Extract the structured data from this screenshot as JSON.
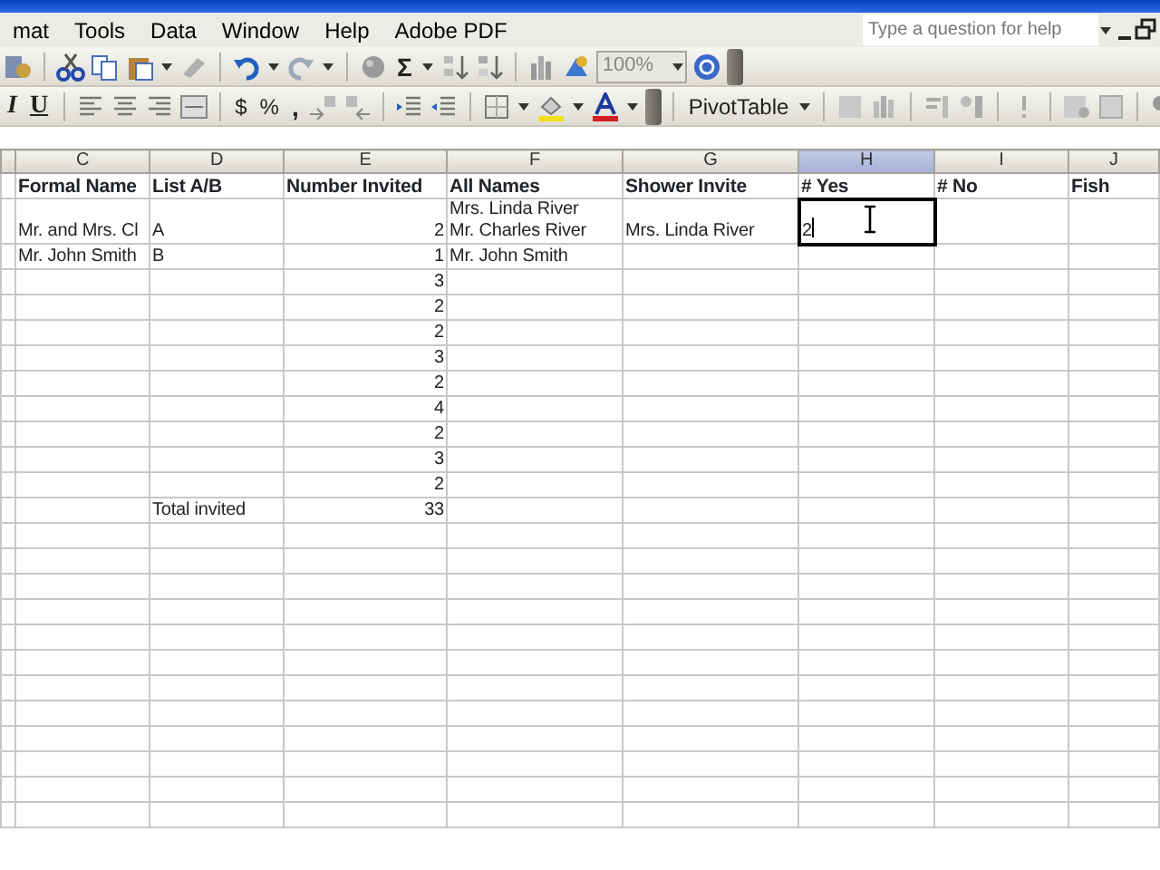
{
  "menu_bar": {
    "items": [
      "mat",
      "Tools",
      "Data",
      "Window",
      "Help",
      "Adobe PDF"
    ],
    "help_field": {
      "placeholder": "Type a question for help"
    }
  },
  "standard_toolbar": {
    "sum": "Σ",
    "zoom": "100%"
  },
  "formatting_toolbar": {
    "italic": "I",
    "underline": "U",
    "currency": "$",
    "percent": "%",
    "comma": ",",
    "pivot_table": "PivotTable"
  },
  "columns": [
    {
      "letter": "C",
      "kind": "text",
      "selected": false
    },
    {
      "letter": "D",
      "kind": "text",
      "selected": false
    },
    {
      "letter": "E",
      "kind": "number",
      "selected": false
    },
    {
      "letter": "F",
      "kind": "text",
      "selected": false
    },
    {
      "letter": "G",
      "kind": "text",
      "selected": false
    },
    {
      "letter": "H",
      "kind": "text",
      "selected": true
    },
    {
      "letter": "I",
      "kind": "text",
      "selected": false
    },
    {
      "letter": "J",
      "kind": "text",
      "selected": false
    }
  ],
  "field_row": {
    "C": "Formal Name",
    "D": "List A/B",
    "E": "Number Invited",
    "F": "All Names",
    "G": "Shower Invite",
    "H": "# Yes",
    "I": "# No",
    "J": "Fish"
  },
  "rows": [
    {
      "cells": {
        "C": "Mr. and Mrs. Cl",
        "D": "A",
        "E": "2",
        "F": "Mrs. Linda River\nMr. Charles River",
        "G": "Mrs. Linda River",
        "H": "2"
      },
      "active": true,
      "editing": true
    },
    {
      "cells": {
        "C": "Mr. John Smith",
        "D": "B",
        "E": "1",
        "F": "Mr. John Smith"
      }
    },
    {
      "cells": {
        "E": "3"
      }
    },
    {
      "cells": {
        "E": "2"
      }
    },
    {
      "cells": {
        "E": "2"
      }
    },
    {
      "cells": {
        "E": "3"
      }
    },
    {
      "cells": {
        "E": "2"
      }
    },
    {
      "cells": {
        "E": "4"
      }
    },
    {
      "cells": {
        "E": "2"
      }
    },
    {
      "cells": {
        "E": "3"
      }
    },
    {
      "cells": {
        "E": "2"
      }
    },
    {
      "cells": {
        "D": "Total invited",
        "E": "33"
      }
    }
  ]
}
